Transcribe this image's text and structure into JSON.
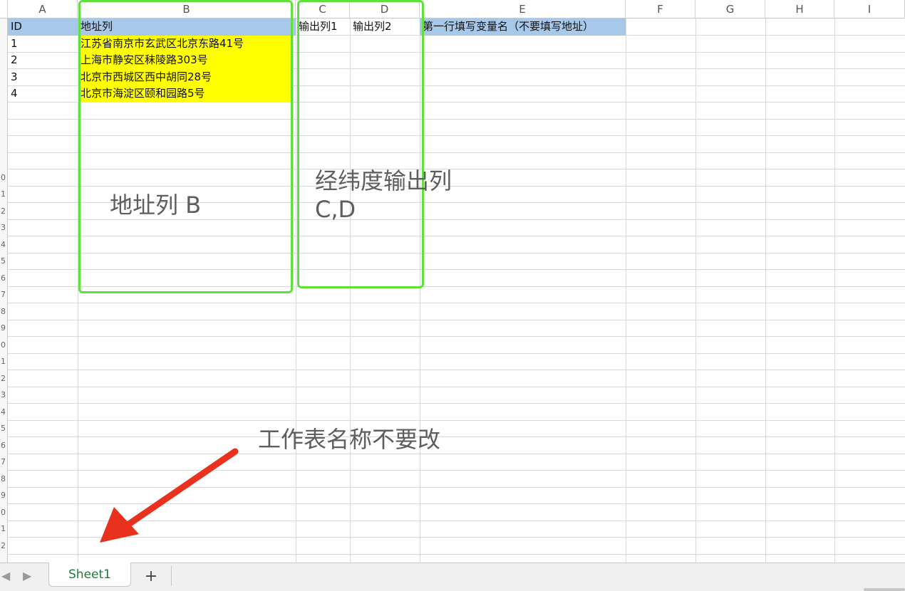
{
  "columns": [
    "A",
    "B",
    "C",
    "D",
    "E",
    "F",
    "G",
    "H",
    "I"
  ],
  "header_row": [
    "ID",
    "地址列",
    "输出列1",
    "输出列2",
    "第一行填写变量名（不要填写地址）"
  ],
  "data_rows": [
    {
      "id": "1",
      "address": "江苏省南京市玄武区北京东路41号"
    },
    {
      "id": "2",
      "address": "上海市静安区秣陵路303号"
    },
    {
      "id": "3",
      "address": "北京市西城区西中胡同28号"
    },
    {
      "id": "4",
      "address": "北京市海淀区颐和园路5号"
    }
  ],
  "row_numbers": [
    "",
    "",
    "",
    "",
    "",
    "",
    "",
    "",
    "",
    "0",
    "1",
    "2",
    "3",
    "4",
    "5",
    "6",
    "7",
    "8",
    "9",
    "0",
    "1",
    "2",
    "3",
    "4",
    "5",
    "6",
    "7",
    "8",
    "9",
    "0",
    "1",
    "2"
  ],
  "annotations": {
    "address_col": "地址列 B",
    "output_cols": "经纬度输出列\nC,D",
    "sheet_note": "工作表名称不要改"
  },
  "sheet_tabs": {
    "active": "Sheet1",
    "add_label": "+",
    "prev_icon": "triangle-left-icon",
    "next_icon": "triangle-right-icon"
  },
  "colors": {
    "header_fill": "#a7c8e9",
    "highlight_fill": "#ffff00",
    "box_green": "#5fe03a",
    "arrow_red": "#e8321e",
    "sheet_tab_text": "#1e7a3c"
  }
}
